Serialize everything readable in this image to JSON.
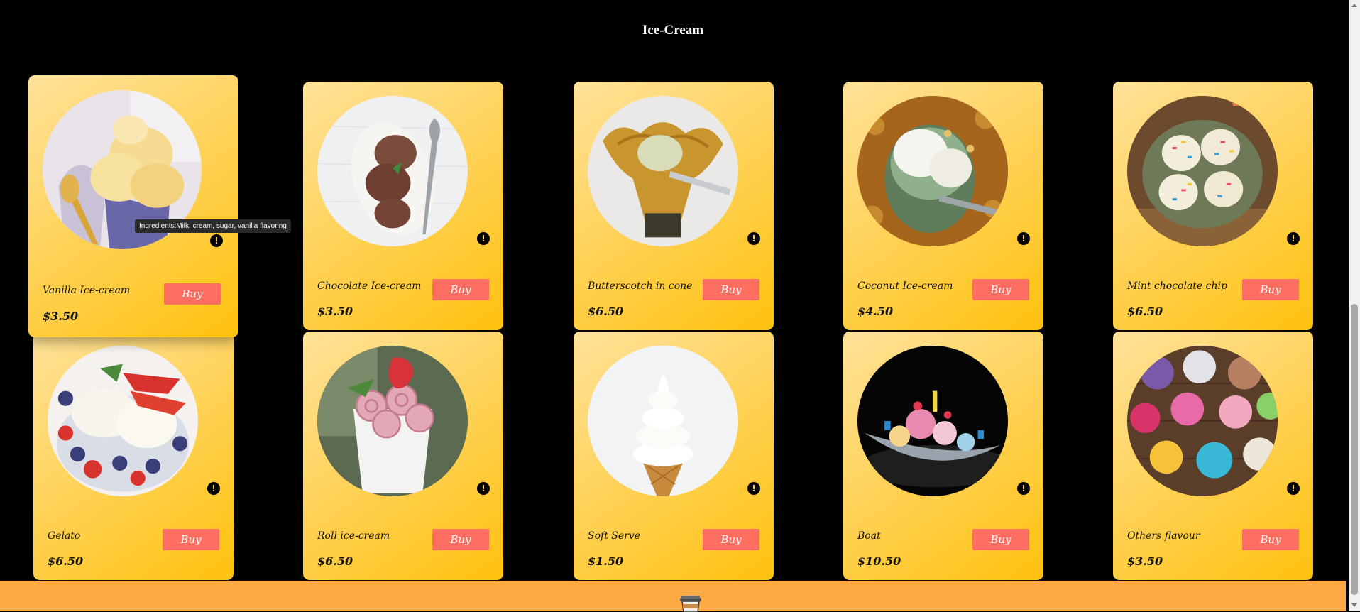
{
  "page_title": "Ice-Cream",
  "buy_label": "Buy",
  "info_glyph": "!",
  "tooltip": "Ingredients:Milk, cream, sugar, vanilla flavoring",
  "products": [
    {
      "name": "Vanilla Ice-cream",
      "price": "$3.50",
      "image": "vanilla-scoops-photo"
    },
    {
      "name": "Chocolate Ice-cream",
      "price": "$3.50",
      "image": "chocolate-scoops-photo"
    },
    {
      "name": "Butterscotch in cone",
      "price": "$6.50",
      "image": "waffle-bowl-photo"
    },
    {
      "name": "Coconut Ice-cream",
      "price": "$4.50",
      "image": "coconut-bowl-photo"
    },
    {
      "name": "Mint chocolate chip",
      "price": "$6.50",
      "image": "sprinkle-scoops-photo"
    },
    {
      "name": "Gelato",
      "price": "$6.50",
      "image": "berry-gelato-photo"
    },
    {
      "name": "Roll ice-cream",
      "price": "$6.50",
      "image": "strawberry-roll-photo"
    },
    {
      "name": "Soft Serve",
      "price": "$1.50",
      "image": "soft-serve-cone-photo"
    },
    {
      "name": "Boat",
      "price": "$10.50",
      "image": "banana-boat-photo"
    },
    {
      "name": "Others flavour",
      "price": "$3.50",
      "image": "assorted-tubs-photo"
    }
  ],
  "colors": {
    "background": "#000000",
    "card_gradient_start": "#ffe29a",
    "card_gradient_end": "#ffc10d",
    "buy_button": "#ff6f61",
    "footer": "#ffa944"
  }
}
